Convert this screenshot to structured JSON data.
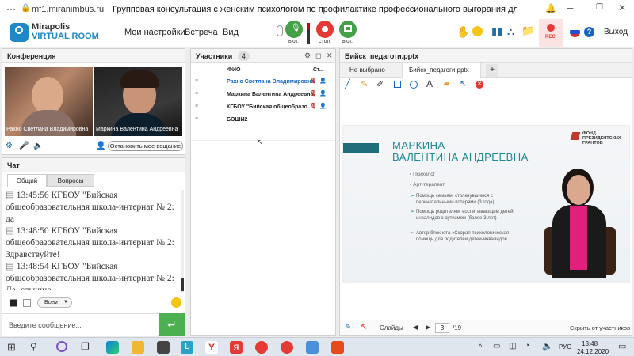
{
  "browser": {
    "url": "mf1.miranimbus.ru",
    "title": "Групповая консультация с женским психологом по профилактике профессионального выгорания для педаг..."
  },
  "app": {
    "logo_line1": "Mirapolis",
    "logo_line2": "VIRTUAL ROOM",
    "menu": [
      "Мои настройки",
      "Встреча",
      "Вид"
    ],
    "mic_label": "вкл.",
    "record_label": "стоп",
    "screen_label": "вкл.",
    "rec_badge": "REC",
    "exit_label": "Выход"
  },
  "conference": {
    "title": "Конференция",
    "video1_name": "Рахно Светлана Владимировна",
    "video2_name": "Маркина Валентина Андреевна",
    "stop_button": "Остановить мое вещание"
  },
  "chat": {
    "title": "Чат",
    "tabs": [
      "Общий",
      "Вопросы"
    ],
    "messages": [
      {
        "time": "13:45:56",
        "text": "КГБОУ \"Бийская общеобразовательная школа-интернат № 2: да"
      },
      {
        "time": "13:48:50",
        "text": "КГБОУ \"Бийская общеобразовательная школа-интернат № 2: Здравствуйте!"
      },
      {
        "time": "13:48:54",
        "text": "КГБОУ \"Бийская общеобразовательная школа-интернат № 2: Да, слышно"
      }
    ],
    "audience": "Всем",
    "input_placeholder": "Введите сообщение..."
  },
  "participants": {
    "title": "Участники",
    "count": "4",
    "col_name": "ФИО",
    "col_status": "Ст...",
    "rows": [
      "Рахно Светлана Владимировна",
      "Маркина Валентина Андреевна",
      "КГБОУ \"Бийская общеобразо...",
      "БОШИ2"
    ]
  },
  "presentation": {
    "title": "Бийск_педагоги.pptx",
    "tab_none": "Не выбрано",
    "tab_file": "Бийск_педагоги.pptx",
    "tab_add": "+",
    "slide": {
      "name_line1": "МАРКИНА",
      "name_line2": "ВАЛЕНТИНА АНДРЕЕВНА",
      "fund_line1": "ФОНД",
      "fund_line2": "ПРЕЗИДЕНТСКИХ",
      "fund_line3": "ГРАНТОВ",
      "roles": [
        "Психолог",
        "Арт-терапевт"
      ],
      "bullets": [
        "Помощь семьям, столкнувшимся с перинатальными потерями (3 года)",
        "Помощь родителям, воспитывающим детей-инвалидов с аутизмом (более 3 лет)",
        "Автор блокнота «Скорая психологическая помощь для родителей детей-инвалидов"
      ]
    },
    "bottom": {
      "slides_label": "Слайды",
      "page": "3",
      "total": "/19",
      "hidden_label": "Скрыть от участников"
    }
  },
  "taskbar": {
    "lang": "РУС",
    "time": "13:48",
    "date": "24.12.2020"
  },
  "colors": {
    "accent_green": "#4caf50",
    "accent_blue": "#1565c0",
    "record_red": "#e53935",
    "slide_teal": "#1f8a96"
  }
}
